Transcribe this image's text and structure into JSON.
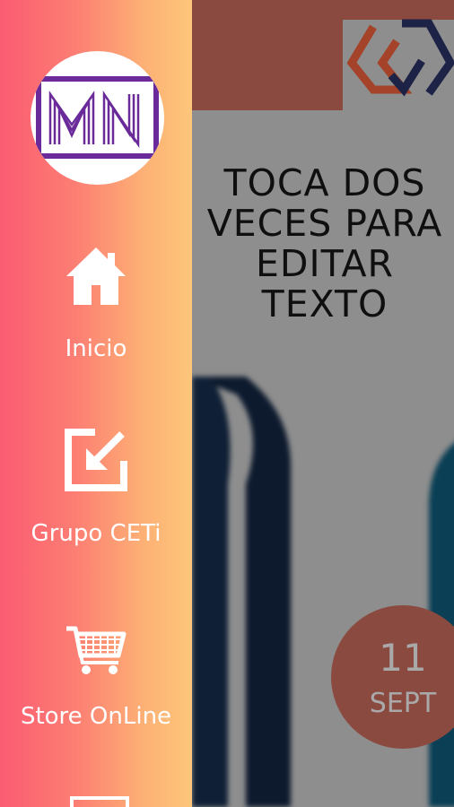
{
  "main": {
    "headline_lines": [
      "TOCA DOS",
      "VECES PARA",
      "EDITAR",
      "TEXTO"
    ],
    "date": {
      "day": "11",
      "month": "SEPT"
    }
  },
  "drawer": {
    "avatar": {
      "initials": "MN"
    },
    "items": [
      {
        "label": "Inicio",
        "icon": "home-icon"
      },
      {
        "label": "Grupo CETi",
        "icon": "external-link-icon"
      },
      {
        "label": "Store OnLine",
        "icon": "cart-icon"
      }
    ]
  },
  "colors": {
    "drawer_gradient_start": "#fb5b72",
    "drawer_gradient_end": "#fdc67a",
    "avatar_purple": "#6a2a9a",
    "brown_accent": "#8a4a3f",
    "navy": "#0d1a2e",
    "teal": "#0a3f55"
  }
}
